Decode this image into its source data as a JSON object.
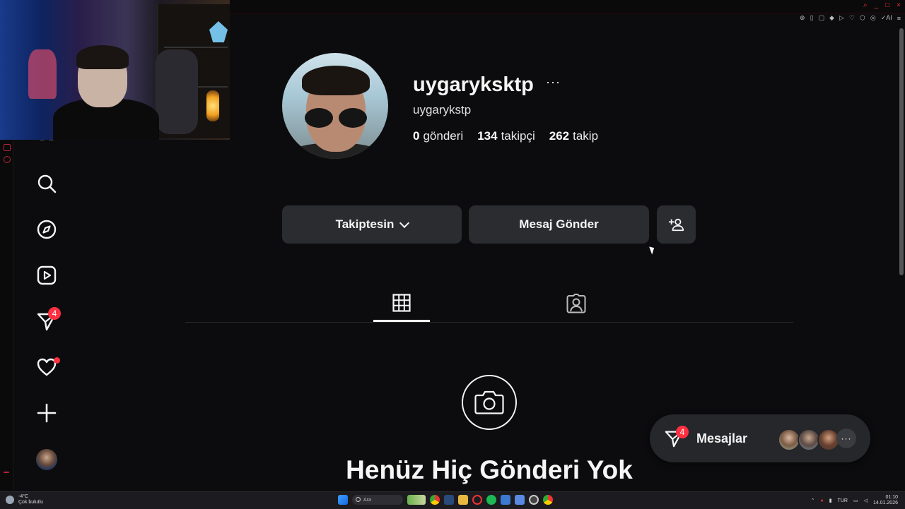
{
  "browser": {
    "window_controls": [
      "search",
      "_",
      "□",
      "×"
    ]
  },
  "profile": {
    "username": "uygaryksktp",
    "more_label": "···",
    "fullname": "uygarykstp",
    "stats": [
      {
        "value": "0",
        "label": "gönderi"
      },
      {
        "value": "134",
        "label": "takipçi"
      },
      {
        "value": "262",
        "label": "takip"
      }
    ]
  },
  "actions": {
    "follow_label": "Takiptesin",
    "message_label": "Mesaj Gönder"
  },
  "sidenav": {
    "messages_badge": "4",
    "items": [
      "grid-icon",
      "search-icon",
      "compass-icon",
      "reels-icon",
      "messages-icon",
      "heart-icon",
      "plus-icon",
      "profile-avatar"
    ]
  },
  "tabs": [
    {
      "name": "posts",
      "icon": "grid-icon",
      "active": true
    },
    {
      "name": "tagged",
      "icon": "tagged-icon",
      "active": false
    }
  ],
  "empty_state": {
    "title": "Henüz Hiç Gönderi Yok"
  },
  "messages_bar": {
    "label": "Mesajlar",
    "badge": "4",
    "more": "···"
  },
  "taskbar": {
    "weather_temp": "-4°C",
    "weather_desc": "Çok bulutlu",
    "search_placeholder": "Ara",
    "language": "TUR",
    "time": "01:10",
    "date": "14.01.2026"
  },
  "colors": {
    "background": "#0c0c0e",
    "button": "#2a2c30",
    "badge": "#ff3040",
    "text": "#f5f5f5"
  }
}
